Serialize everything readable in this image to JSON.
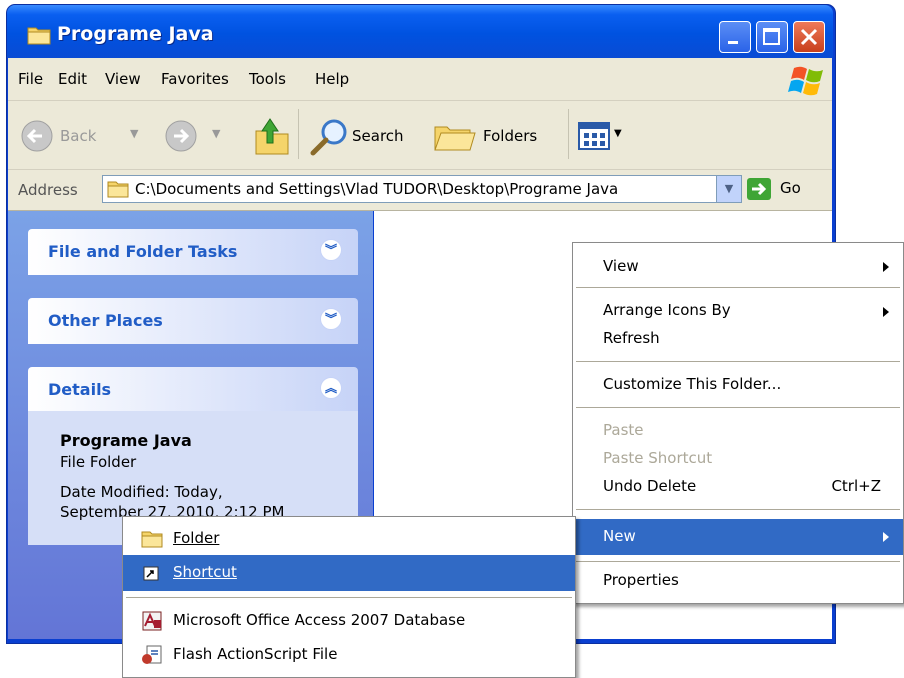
{
  "window": {
    "title": "Programe Java"
  },
  "menubar": {
    "items": [
      "File",
      "Edit",
      "View",
      "Favorites",
      "Tools",
      "Help"
    ]
  },
  "toolbar": {
    "back_label": "Back",
    "search_label": "Search",
    "folders_label": "Folders"
  },
  "address": {
    "label": "Address",
    "value": "C:\\Documents and Settings\\Vlad TUDOR\\Desktop\\Programe Java",
    "go_label": "Go"
  },
  "tasks": {
    "file_folder_tasks": "File and Folder Tasks",
    "other_places": "Other Places",
    "details": "Details",
    "details_name": "Programe Java",
    "details_type": "File Folder",
    "details_modified_1": "Date Modified: Today,",
    "details_modified_2": "September 27, 2010, 2:12 PM"
  },
  "context_menu": {
    "view": "View",
    "arrange": "Arrange Icons By",
    "refresh": "Refresh",
    "customize": "Customize This Folder...",
    "paste": "Paste",
    "paste_shortcut": "Paste Shortcut",
    "undo_delete": "Undo Delete",
    "undo_shortcut": "Ctrl+Z",
    "new": "New",
    "properties": "Properties"
  },
  "new_submenu": {
    "folder": "Folder",
    "shortcut": "Shortcut",
    "access": "Microsoft Office Access 2007 Database",
    "flash": "Flash ActionScript File"
  },
  "colors": {
    "title_blue": "#0054e3",
    "menu_highlight": "#316ac5",
    "pane_blue": "#6375d6",
    "header_text": "#215dc6"
  }
}
